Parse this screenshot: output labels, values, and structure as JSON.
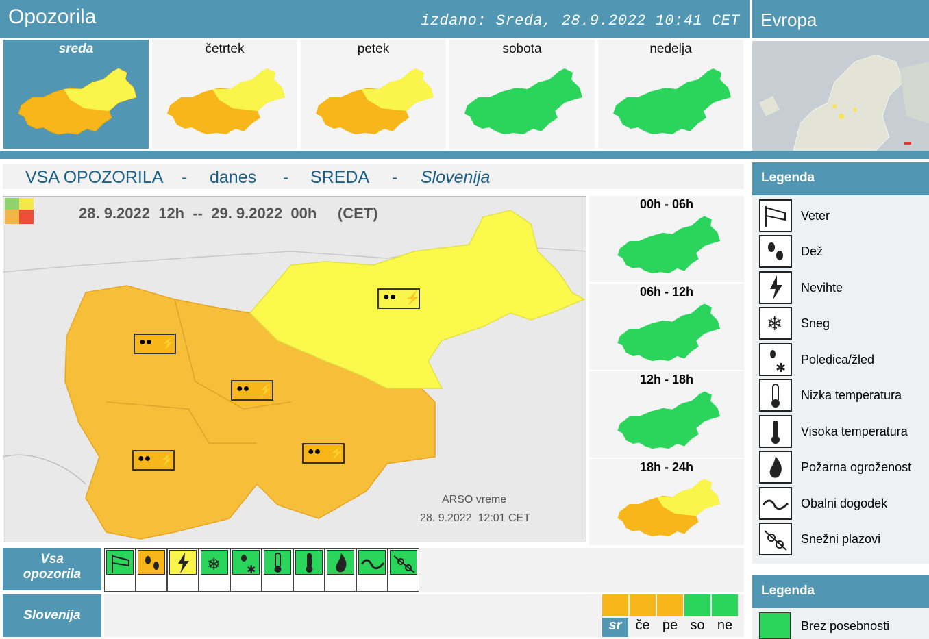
{
  "header": {
    "title": "Opozorila",
    "issued": "izdano: Sreda, 28.9.2022 10:41 CET",
    "europe_title": "Evropa"
  },
  "colors": {
    "accent": "#5197b4",
    "green": "#2bd55c",
    "yellow": "#faf54a",
    "orange": "#f7b71b",
    "title_text": "#1a5e86"
  },
  "days": [
    {
      "label": "sreda",
      "active": true,
      "warning": "orange"
    },
    {
      "label": "četrtek",
      "active": false,
      "warning": "orange"
    },
    {
      "label": "petek",
      "active": false,
      "warning": "orange"
    },
    {
      "label": "sobota",
      "active": false,
      "warning": "green"
    },
    {
      "label": "nedelja",
      "active": false,
      "warning": "green"
    }
  ],
  "section": {
    "all": "VSA OPOZORILA",
    "sep1": "-",
    "today": "danes",
    "sep2": "-",
    "day": "SREDA",
    "sep3": "-",
    "region": "Slovenija"
  },
  "main_map": {
    "period": "28. 9.2022  12h  --  29. 9.2022  00h     (CET)",
    "credit": "ARSO vreme",
    "credit_time": "28. 9.2022  12:01 CET"
  },
  "slots": [
    {
      "label": "00h - 06h",
      "warning": "green"
    },
    {
      "label": "06h - 12h",
      "warning": "green"
    },
    {
      "label": "12h - 18h",
      "warning": "green"
    },
    {
      "label": "18h - 24h",
      "warning": "orange"
    }
  ],
  "legend": {
    "title": "Legenda",
    "items": [
      {
        "icon": "wind-icon",
        "label": "Veter"
      },
      {
        "icon": "rain-icon",
        "label": "Dež"
      },
      {
        "icon": "thunderstorm-icon",
        "label": "Nevihte"
      },
      {
        "icon": "snow-icon",
        "label": "Sneg"
      },
      {
        "icon": "glaze-icon",
        "label": "Poledica/žled"
      },
      {
        "icon": "low-temperature-icon",
        "label": "Nizka temperatura"
      },
      {
        "icon": "high-temperature-icon",
        "label": "Visoka temperatura"
      },
      {
        "icon": "fire-danger-icon",
        "label": "Požarna ogroženost"
      },
      {
        "icon": "coastal-event-icon",
        "label": "Obalni dogodek"
      },
      {
        "icon": "avalanche-icon",
        "label": "Snežni plazovi"
      }
    ]
  },
  "legend2": {
    "title": "Legenda",
    "item": "Brez posebnosti"
  },
  "bottom": {
    "all_label_1": "Vsa",
    "all_label_2": "opozorila",
    "types": [
      {
        "icon": "wind-icon",
        "status": "green"
      },
      {
        "icon": "rain-icon",
        "status": "orange"
      },
      {
        "icon": "thunderstorm-icon",
        "status": "yellow"
      },
      {
        "icon": "snow-icon",
        "status": "green"
      },
      {
        "icon": "glaze-icon",
        "status": "green"
      },
      {
        "icon": "low-temperature-icon",
        "status": "green"
      },
      {
        "icon": "high-temperature-icon",
        "status": "green"
      },
      {
        "icon": "fire-danger-icon",
        "status": "green"
      },
      {
        "icon": "coastal-event-icon",
        "status": "green"
      },
      {
        "icon": "avalanche-icon",
        "status": "green"
      }
    ],
    "region_label": "Slovenija",
    "day_cells": [
      {
        "label": "sr",
        "status": "orange",
        "active": true
      },
      {
        "label": "če",
        "status": "orange",
        "active": false
      },
      {
        "label": "pe",
        "status": "orange",
        "active": false
      },
      {
        "label": "so",
        "status": "green",
        "active": false
      },
      {
        "label": "ne",
        "status": "green",
        "active": false
      }
    ]
  }
}
